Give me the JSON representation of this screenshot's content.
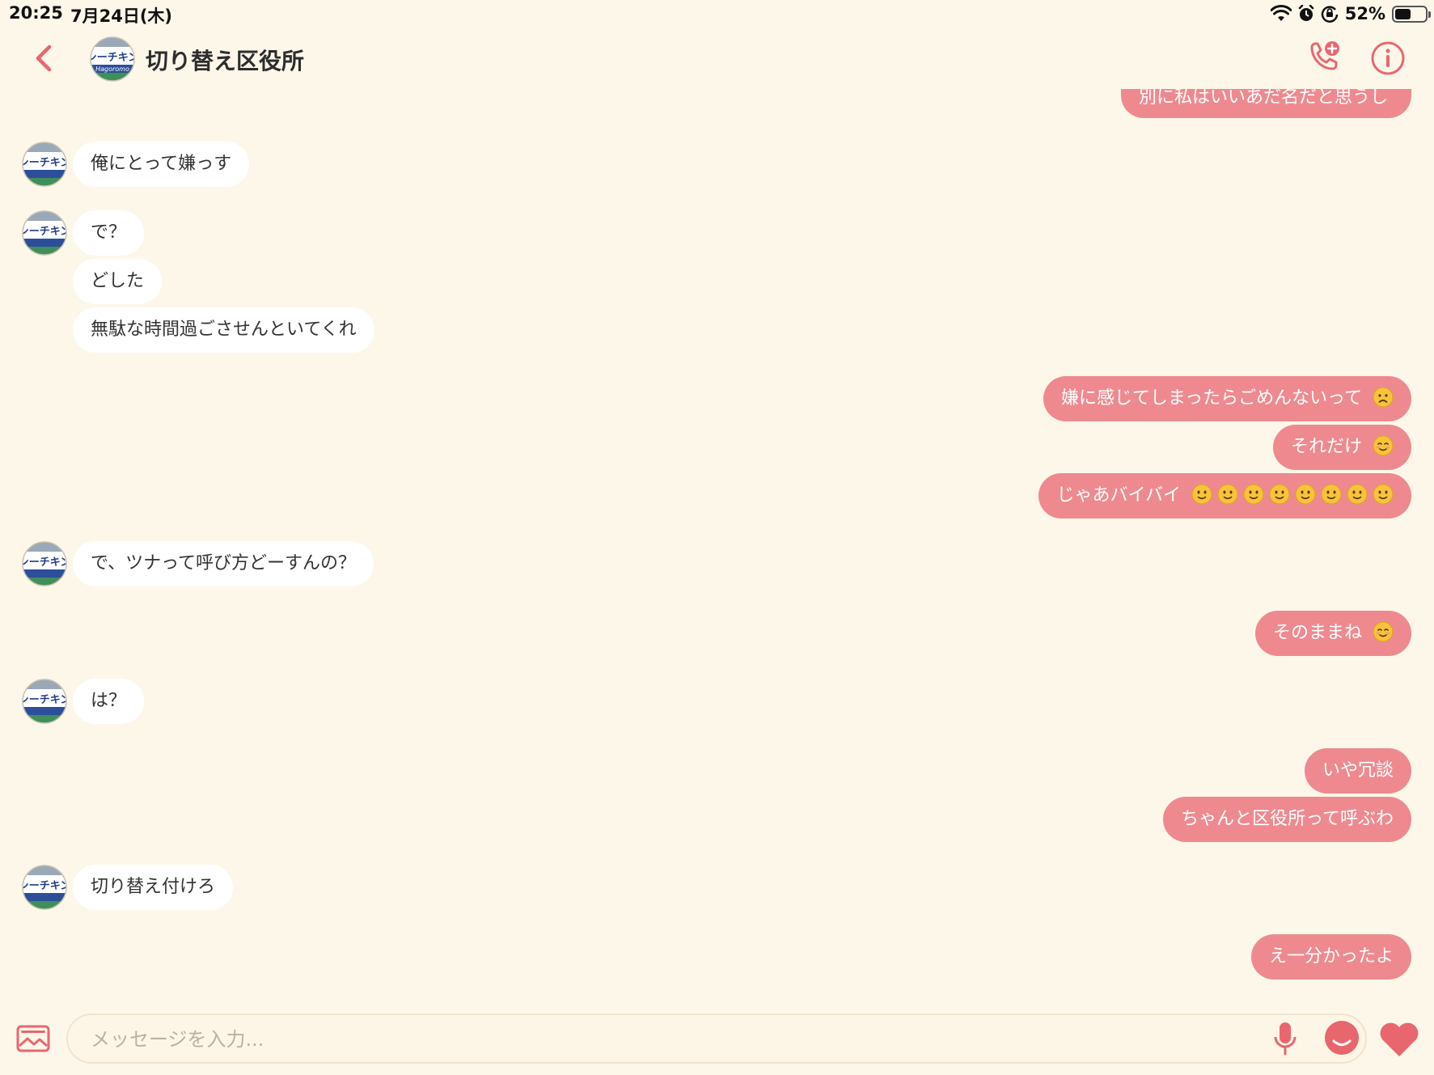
{
  "status_bar": {
    "time": "20:25",
    "date": "7月24日(木)",
    "battery_percent": "52%",
    "battery_level": 0.52,
    "icons": [
      "wifi-icon",
      "alarm-icon",
      "orientation-lock-icon",
      "battery-icon"
    ]
  },
  "header": {
    "title": "切り替え区役所",
    "avatar_label": "シーチキン",
    "actions": [
      "back-icon",
      "add-call-icon",
      "info-icon"
    ]
  },
  "messages": {
    "m0": "別に私はいいあだ名だと思うし",
    "m1": "俺にとって嫌っす",
    "m2": "で？",
    "m3": "どした",
    "m4": "無駄な時間過ごさせんといてくれ",
    "m5": "嫌に感じてしまったらごめんないって",
    "m6": "それだけ",
    "m7": "じゃあバイバイ",
    "m8": "で、ツナって呼び方どーすんの？",
    "m9": "そのままね",
    "m10": "は？",
    "m11": "いや冗談",
    "m12": "ちゃんと区役所って呼ぶわ",
    "m13": "切り替え付けろ",
    "m14": "え一分かったよ"
  },
  "emoji": {
    "m5": "frowning-face",
    "m6": "smiling-face",
    "m7": "slightly-smiling-face x8",
    "m9": "smiling-face"
  },
  "input": {
    "placeholder": "メッセージを入力..."
  },
  "colors": {
    "background": "#fdf7ea",
    "outgoing_bubble": "#ee8a8f",
    "incoming_bubble": "#ffffff",
    "accent": "#e8676e"
  }
}
